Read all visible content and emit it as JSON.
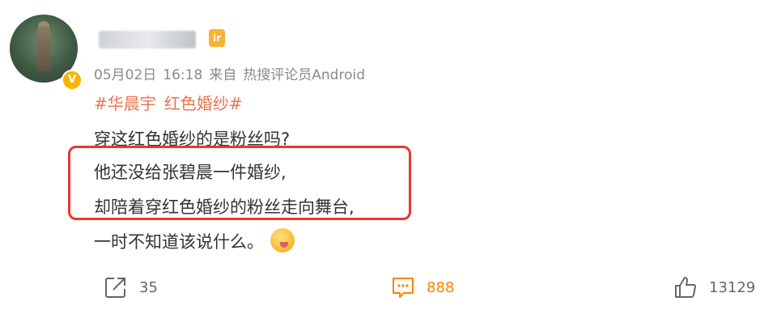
{
  "post": {
    "username": "",
    "meta": {
      "date": "05月02日",
      "time": "16:18",
      "source_prefix": "来自",
      "source": "热搜评论员Android"
    },
    "topics": [
      "#华晨宇",
      "红色婚纱#"
    ],
    "lines": [
      "穿这红色婚纱的是粉丝吗?",
      "他还没给张碧晨一件婚纱,",
      "却陪着穿红色婚纱的粉丝走向舞台,",
      "一时不知道该说什么。"
    ]
  },
  "actions": {
    "share_count": "35",
    "comment_count": "888",
    "like_count": "13129"
  },
  "colors": {
    "accent": "#ff8200",
    "topic": "#eb7350",
    "highlight_border": "#e8372d",
    "verified": "#f7b500"
  },
  "icons": {
    "share": "share-icon",
    "comment": "comment-icon",
    "like": "thumbs-up-icon",
    "verified": "verified-badge-icon",
    "level": "level-badge-icon",
    "emoji": "drooling-emoji-icon"
  }
}
